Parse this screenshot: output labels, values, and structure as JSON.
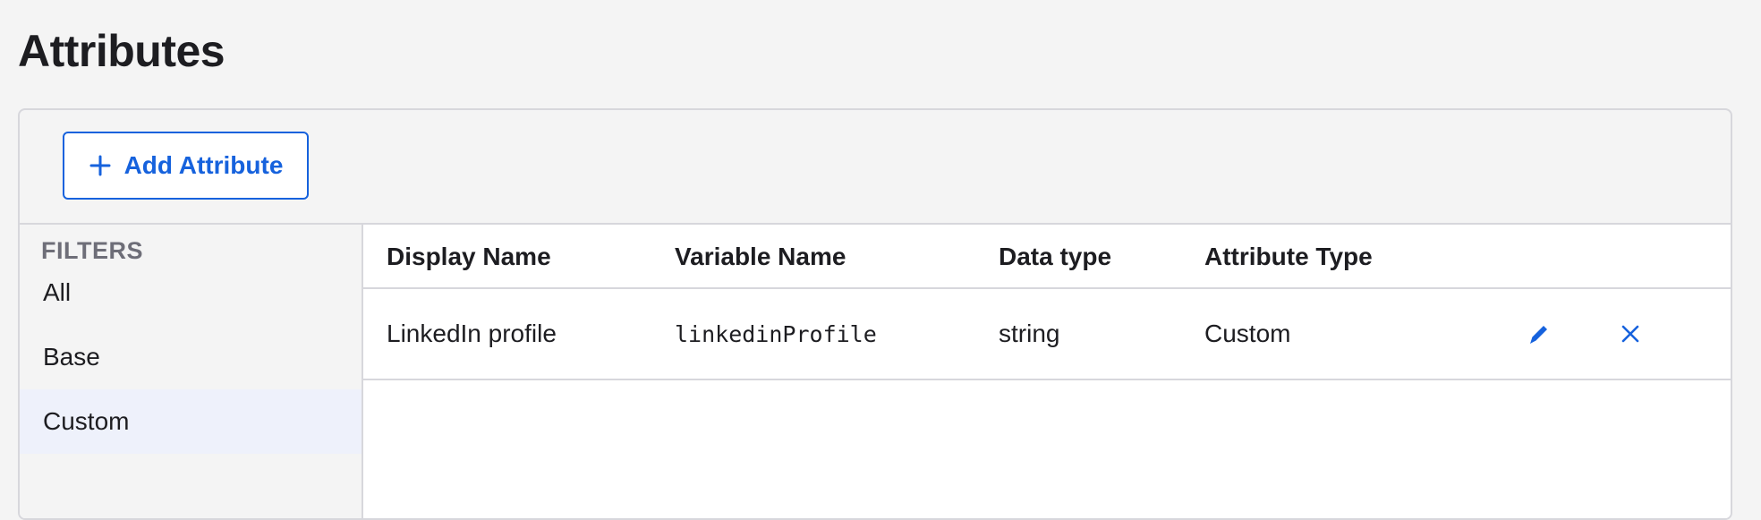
{
  "page": {
    "title": "Attributes"
  },
  "toolbar": {
    "add_label": "Add Attribute",
    "add_icon": "plus-icon"
  },
  "filters": {
    "heading": "FILTERS",
    "items": [
      {
        "label": "All",
        "active": false
      },
      {
        "label": "Base",
        "active": false
      },
      {
        "label": "Custom",
        "active": true
      }
    ]
  },
  "table": {
    "columns": [
      "Display Name",
      "Variable Name",
      "Data type",
      "Attribute Type"
    ],
    "rows": [
      {
        "display_name": "LinkedIn profile",
        "variable_name": "linkedinProfile",
        "data_type": "string",
        "attribute_type": "Custom",
        "actions": [
          "pencil-icon",
          "close-icon"
        ]
      }
    ]
  },
  "colors": {
    "accent": "#1662dd",
    "active_filter_bg": "#eef1fb",
    "border": "#d7d7dc",
    "page_bg": "#f4f4f4"
  }
}
